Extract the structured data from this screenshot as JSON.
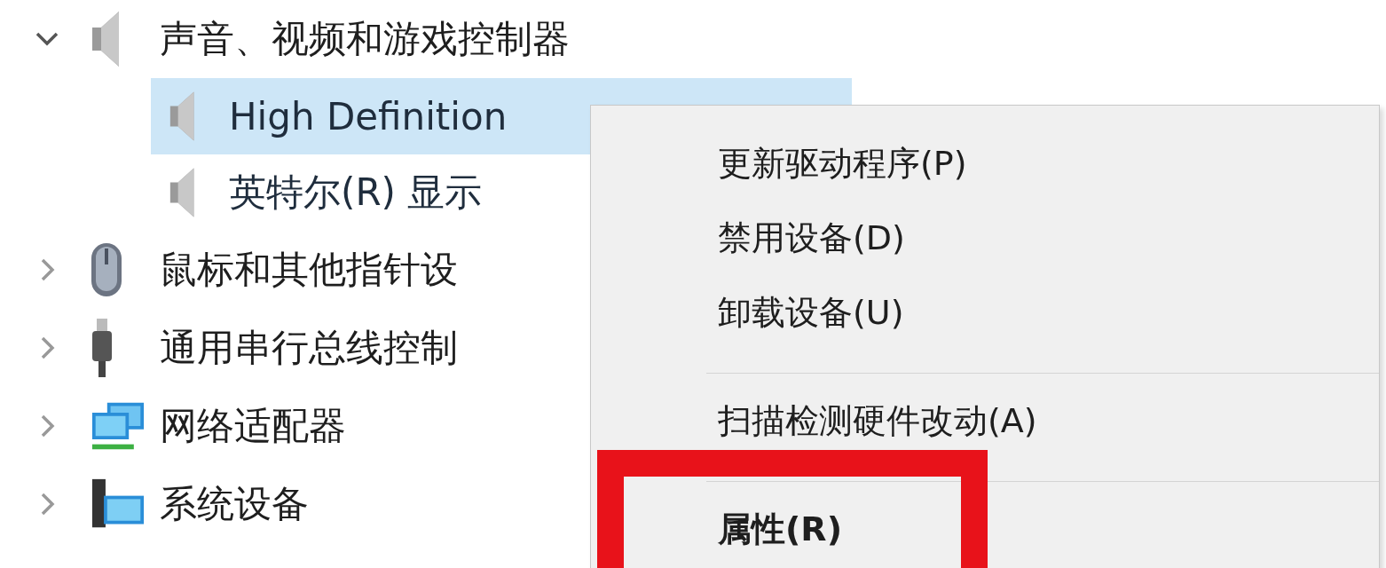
{
  "tree": [
    {
      "label": "声音、视频和游戏控制器",
      "expanded": true,
      "children": [
        {
          "label": "High Definition",
          "selected": true
        },
        {
          "label": "英特尔(R) 显示",
          "selected": false
        }
      ]
    },
    {
      "label": "鼠标和其他指针设",
      "expanded": false
    },
    {
      "label": "通用串行总线控制",
      "expanded": false
    },
    {
      "label": "网络适配器",
      "expanded": false
    },
    {
      "label": "系统设备",
      "expanded": false
    }
  ],
  "context_menu": [
    {
      "kind": "item",
      "label": "更新驱动程序(P)",
      "default": false
    },
    {
      "kind": "item",
      "label": "禁用设备(D)",
      "default": false
    },
    {
      "kind": "item",
      "label": "卸载设备(U)",
      "default": false
    },
    {
      "kind": "separator"
    },
    {
      "kind": "item",
      "label": "扫描检测硬件改动(A)",
      "default": false
    },
    {
      "kind": "separator"
    },
    {
      "kind": "item",
      "label": "属性(R)",
      "default": true,
      "annotated": true
    }
  ]
}
